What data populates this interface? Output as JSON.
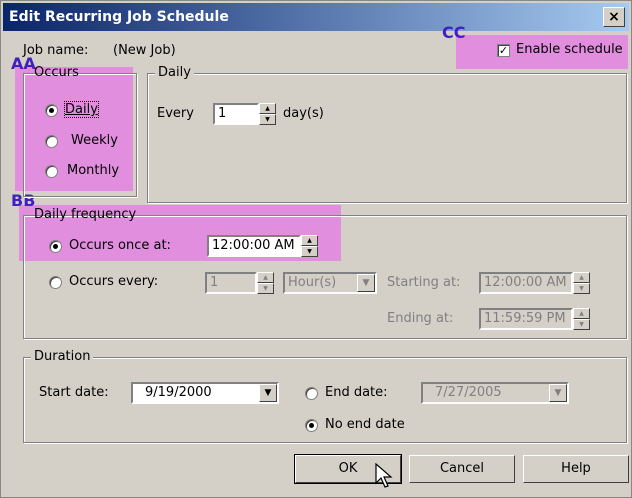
{
  "window": {
    "title": "Edit Recurring Job Schedule",
    "close_label": "×"
  },
  "job": {
    "name_label": "Job name:",
    "name_value": "(New Job)"
  },
  "enable_schedule": {
    "label": "Enable schedule",
    "checked": true
  },
  "annotations": {
    "a": "AA",
    "b": "BB",
    "c": "CC"
  },
  "occurs": {
    "legend": "Occurs",
    "options": [
      {
        "label": "Daily",
        "selected": true
      },
      {
        "label": "Weekly",
        "selected": false
      },
      {
        "label": "Monthly",
        "selected": false
      }
    ]
  },
  "daily": {
    "legend": "Daily",
    "every_label": "Every",
    "every_value": "1",
    "unit": "day(s)"
  },
  "daily_frequency": {
    "legend": "Daily frequency",
    "once_label": "Occurs once at:",
    "once_value": "12:00:00 AM",
    "every_label": "Occurs every:",
    "every_value": "1",
    "every_unit": "Hour(s)",
    "starting_label": "Starting at:",
    "starting_value": "12:00:00 AM",
    "ending_label": "Ending at:",
    "ending_value": "11:59:59 PM"
  },
  "duration": {
    "legend": "Duration",
    "start_label": "Start date:",
    "start_value": "9/19/2000",
    "end_label": "End date:",
    "end_value": "7/27/2005",
    "no_end_label": "No end date"
  },
  "buttons": {
    "ok": "OK",
    "cancel": "Cancel",
    "help": "Help"
  },
  "colors": {
    "highlight": "#e678e6",
    "annotation": "#4020c0",
    "titlebar": "#0a246a"
  }
}
